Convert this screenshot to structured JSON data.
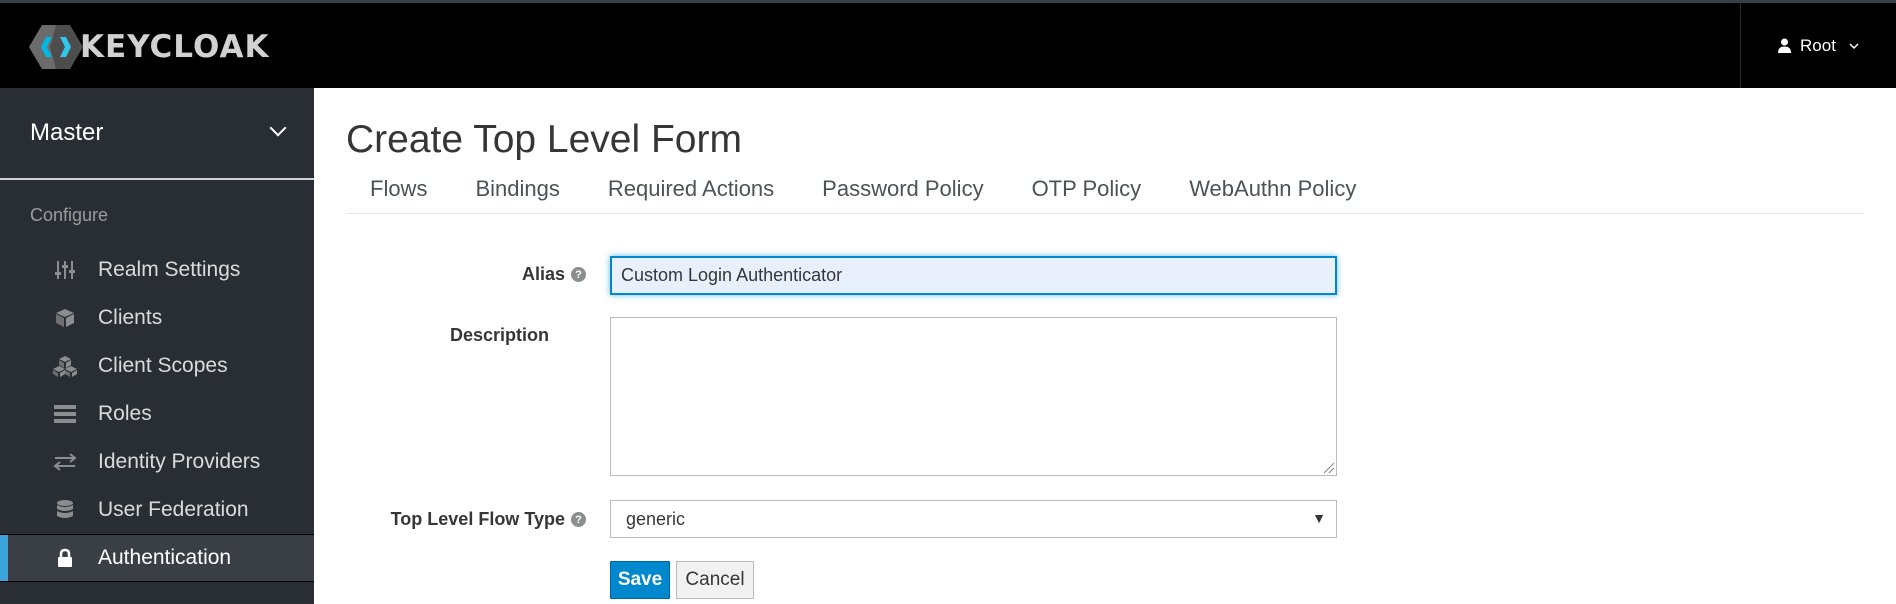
{
  "header": {
    "brand": "KEYCLOAK",
    "user": "Root"
  },
  "sidebar": {
    "realm": "Master",
    "section": "Configure",
    "items": [
      {
        "label": "Realm Settings",
        "icon": "sliders-icon"
      },
      {
        "label": "Clients",
        "icon": "cube-icon"
      },
      {
        "label": "Client Scopes",
        "icon": "cubes-icon"
      },
      {
        "label": "Roles",
        "icon": "list-icon"
      },
      {
        "label": "Identity Providers",
        "icon": "exchange-icon"
      },
      {
        "label": "User Federation",
        "icon": "database-icon"
      },
      {
        "label": "Authentication",
        "icon": "lock-icon"
      }
    ]
  },
  "main": {
    "title": "Create Top Level Form",
    "tabs": [
      "Flows",
      "Bindings",
      "Required Actions",
      "Password Policy",
      "OTP Policy",
      "WebAuthn Policy"
    ],
    "form": {
      "alias_label": "Alias",
      "alias_value": "Custom Login Authenticator",
      "description_label": "Description",
      "description_value": "",
      "flow_type_label": "Top Level Flow Type",
      "flow_type_value": "generic",
      "save": "Save",
      "cancel": "Cancel"
    }
  },
  "colors": {
    "accent": "#0088ce",
    "active_bar": "#39a5dc",
    "sidebar_bg": "#292e34"
  }
}
